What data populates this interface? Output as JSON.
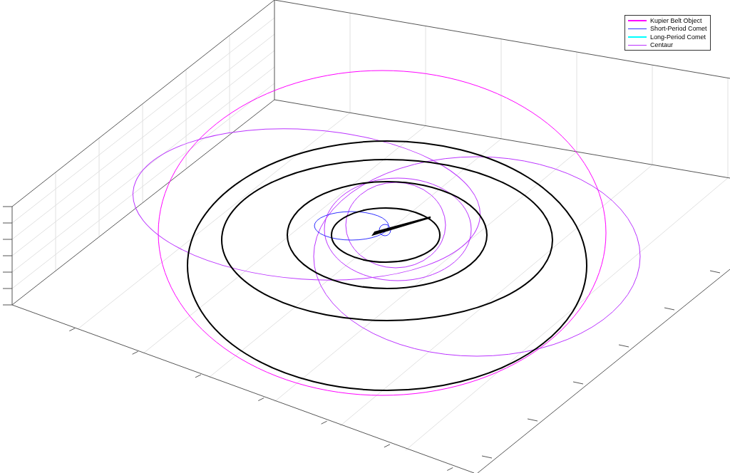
{
  "legend": [
    {
      "label": "Kupier Belt Object",
      "color": "#ff00ff"
    },
    {
      "label": "Short-Period Comet",
      "color": "#3030ff"
    },
    {
      "label": "Long-Period Comet",
      "color": "#00ffff"
    },
    {
      "label": "Centaur",
      "color": "#bb33ff"
    }
  ]
}
